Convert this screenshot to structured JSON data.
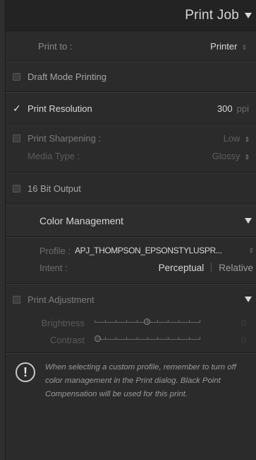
{
  "header": {
    "title": "Print Job"
  },
  "print_to": {
    "label": "Print to :",
    "value": "Printer"
  },
  "draft_mode": {
    "label": "Draft Mode Printing"
  },
  "print_resolution": {
    "label": "Print Resolution",
    "value": "300",
    "unit": "ppi"
  },
  "print_sharpening": {
    "label": "Print Sharpening :",
    "value": "Low"
  },
  "media_type": {
    "label": "Media Type :",
    "value": "Glossy"
  },
  "bit16": {
    "label": "16 Bit Output"
  },
  "color_management": {
    "title": "Color Management",
    "profile_label": "Profile :",
    "profile_value": "APJ_THOMPSON_EPSONSTYLUSPR...",
    "intent_label": "Intent :",
    "intent_options": [
      "Perceptual",
      "Relative"
    ],
    "intent_selected": "Perceptual"
  },
  "print_adjustment": {
    "title": "Print Adjustment",
    "brightness_label": "Brightness",
    "brightness_value": "0",
    "brightness_level": 0.5,
    "contrast_label": "Contrast",
    "contrast_value": "0",
    "contrast_level": 0.0
  },
  "notice": {
    "icon": "exclamation-icon",
    "text": "When selecting a custom profile, remember to turn off color management in the Print dialog. Black Point Compensation will be used for this print."
  }
}
